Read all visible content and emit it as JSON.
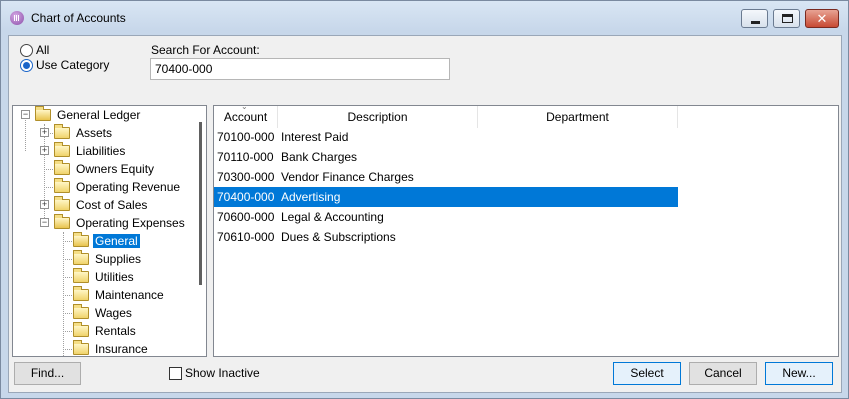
{
  "window": {
    "title": "Chart of Accounts",
    "close_glyph": "✕"
  },
  "filter": {
    "radio_all_label": "All",
    "radio_category_label": "Use Category",
    "selected": "Use Category"
  },
  "search": {
    "label": "Search For Account:",
    "value": "70400-000"
  },
  "tree": {
    "root": "General Ledger",
    "items": [
      {
        "label": "Assets"
      },
      {
        "label": "Liabilities"
      },
      {
        "label": "Owners Equity"
      },
      {
        "label": "Operating Revenue"
      },
      {
        "label": "Cost of Sales"
      },
      {
        "label": "Operating Expenses"
      }
    ],
    "children": [
      {
        "label": "General",
        "selected": true
      },
      {
        "label": "Supplies"
      },
      {
        "label": "Utilities"
      },
      {
        "label": "Maintenance"
      },
      {
        "label": "Wages"
      },
      {
        "label": "Rentals"
      },
      {
        "label": "Insurance"
      }
    ]
  },
  "grid": {
    "columns": [
      "Account",
      "Description",
      "Department"
    ],
    "rows": [
      {
        "account": "70100-000",
        "description": "Interest Paid",
        "department": ""
      },
      {
        "account": "70110-000",
        "description": "Bank Charges",
        "department": ""
      },
      {
        "account": "70300-000",
        "description": "Vendor Finance Charges",
        "department": ""
      },
      {
        "account": "70400-000",
        "description": "Advertising",
        "department": "",
        "selected": true
      },
      {
        "account": "70600-000",
        "description": "Legal & Accounting",
        "department": ""
      },
      {
        "account": "70610-000",
        "description": "Dues & Subscriptions",
        "department": ""
      }
    ]
  },
  "footer": {
    "find_label": "Find...",
    "show_inactive_label": "Show Inactive",
    "select_label": "Select",
    "cancel_label": "Cancel",
    "new_label": "New..."
  },
  "colors": {
    "selection": "#0078d7"
  }
}
